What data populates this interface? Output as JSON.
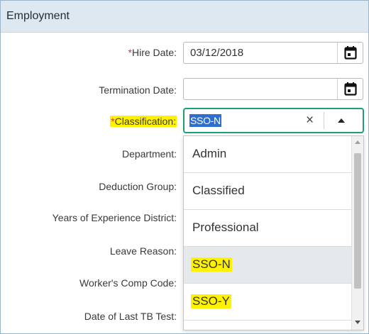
{
  "panel": {
    "title": "Employment"
  },
  "fields": {
    "hire_date": {
      "required_mark": "*",
      "label": "Hire Date:",
      "value": "03/12/2018"
    },
    "termination_date": {
      "label": "Termination Date:",
      "value": ""
    },
    "classification": {
      "required_mark": "*",
      "label": "Classification:",
      "value": "SSO-N",
      "clear_glyph": "×"
    },
    "department": {
      "label": "Department:"
    },
    "deduction_group": {
      "label": "Deduction Group:"
    },
    "years_experience_district": {
      "label": "Years of Experience District:"
    },
    "leave_reason": {
      "label": "Leave Reason:"
    },
    "workers_comp_code": {
      "label": "Worker's Comp Code:"
    },
    "date_last_tb_test": {
      "label": "Date of Last TB Test:"
    }
  },
  "dropdown": {
    "options": [
      {
        "label": "Admin"
      },
      {
        "label": "Classified"
      },
      {
        "label": "Professional"
      },
      {
        "label": "SSO-N"
      },
      {
        "label": "SSO-Y"
      }
    ],
    "selected": "SSO-N"
  },
  "icons": {
    "calendar": "calendar-icon",
    "clear": "clear-icon",
    "caret": "caret-up-icon"
  },
  "colors": {
    "header_bg": "#dde8f0",
    "focus_border": "#1aa179",
    "selection": "#2d6fd0",
    "required": "#d9363e",
    "highlight": "#fff200"
  }
}
